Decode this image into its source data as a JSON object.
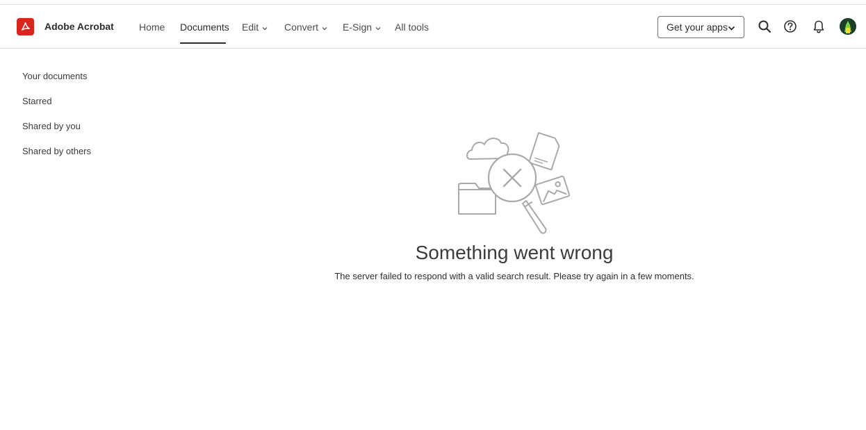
{
  "header": {
    "brand": "Adobe Acrobat",
    "brand_color": "#d7261e",
    "nav": [
      {
        "label": "Home"
      },
      {
        "label": "Documents",
        "active": true
      },
      {
        "label": "Edit",
        "dropdown": true
      },
      {
        "label": "Convert",
        "dropdown": true
      },
      {
        "label": "E-Sign",
        "dropdown": true
      },
      {
        "label": "All tools"
      }
    ],
    "get_apps_label": "Get your apps",
    "icons": [
      "search-icon",
      "help-icon",
      "bell-icon"
    ]
  },
  "sidebar": {
    "items": [
      {
        "label": "Your documents"
      },
      {
        "label": "Starred"
      },
      {
        "label": "Shared by you"
      },
      {
        "label": "Shared by others"
      }
    ]
  },
  "error": {
    "title": "Something went wrong",
    "message": "The server failed to respond with a valid search result. Please try again in a few moments."
  }
}
